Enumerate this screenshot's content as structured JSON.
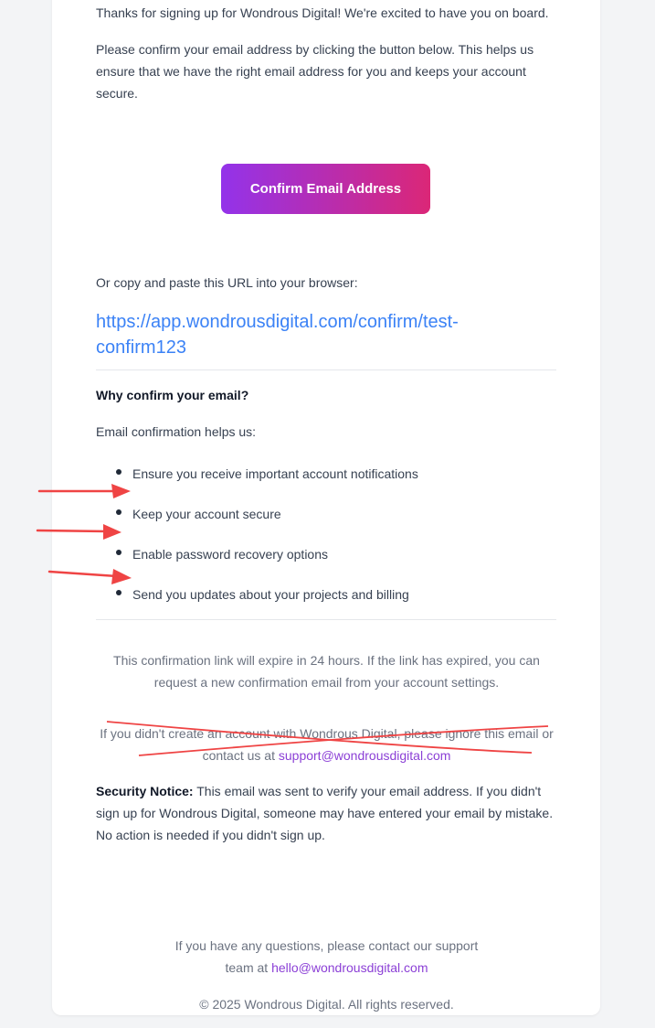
{
  "intro": {
    "thanks": "Thanks for signing up for Wondrous Digital! We're excited to have you on board.",
    "confirm_text": "Please confirm your email address by clicking the button below. This helps us ensure that we have the right email address for you and keeps your account secure."
  },
  "cta": {
    "button_label": "Confirm Email Address"
  },
  "copy_url": {
    "label": "Or copy and paste this URL into your browser:",
    "url": "https://app.wondrousdigital.com/confirm/test-confirm123"
  },
  "why": {
    "heading": "Why confirm your email?",
    "intro": "Email confirmation helps us:",
    "items": [
      "Ensure you receive important account notifications",
      "Keep your account secure",
      "Enable password recovery options",
      "Send you updates about your projects and billing"
    ]
  },
  "expiry": {
    "text": "This confirmation link will expire in 24 hours. If the link has expired, you can request a new confirmation email from your account settings."
  },
  "ignore_notice": {
    "text": "If you didn't create an account with Wondrous Digital, please ignore this email or contact us at",
    "email": "support@wondrousdigital.com"
  },
  "security": {
    "label": "Security Notice:",
    "text": "This email was sent to verify your email address. If you didn't sign up for Wondrous Digital, someone may have entered your email by mistake. No action is needed if you didn't sign up."
  },
  "footer": {
    "questions": "If you have any questions, please contact our support team at",
    "email": "hello@wondrousdigital.com",
    "copyright": "© 2025 Wondrous Digital. All rights reserved."
  },
  "colors": {
    "button_start": "#9333ea",
    "button_end": "#db2777",
    "url_blue": "#3b82f6",
    "link_purple": "#8b3fd6",
    "annotation_red": "#ef4444"
  },
  "annotations": {
    "arrows": [
      "red-arrow",
      "red-arrow",
      "red-arrow"
    ],
    "strikethrough": "red-cross-lines"
  }
}
